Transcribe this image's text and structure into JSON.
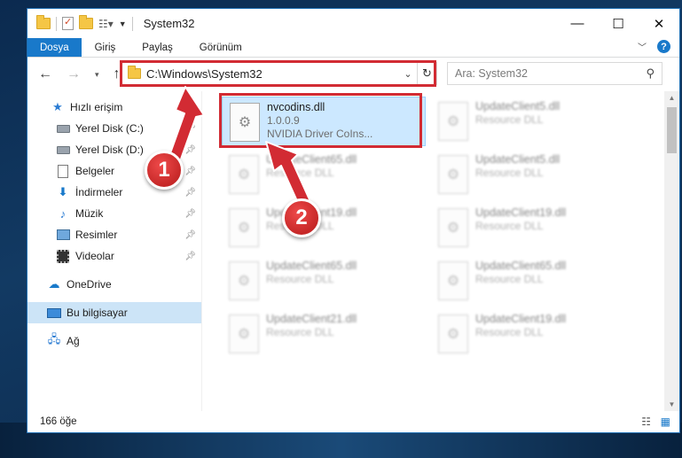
{
  "window": {
    "title": "System32",
    "controls": {
      "minimize": "—",
      "maximize": "☐",
      "close": "✕"
    }
  },
  "ribbon": {
    "tabs": [
      "Dosya",
      "Giriş",
      "Paylaş",
      "Görünüm"
    ],
    "help": "?"
  },
  "address": {
    "path": "C:\\Windows\\System32",
    "search_placeholder": "Ara: System32"
  },
  "sidebar": {
    "items": [
      {
        "label": "Hızlı erişim",
        "icon": "star-icon",
        "pinned": false
      },
      {
        "label": "Yerel Disk (C:)",
        "icon": "drive-icon",
        "pinned": true
      },
      {
        "label": "Yerel Disk (D:)",
        "icon": "drive-icon",
        "pinned": true
      },
      {
        "label": "Belgeler",
        "icon": "documents-icon",
        "pinned": true
      },
      {
        "label": "İndirmeler",
        "icon": "downloads-icon",
        "pinned": true
      },
      {
        "label": "Müzik",
        "icon": "music-icon",
        "pinned": true
      },
      {
        "label": "Resimler",
        "icon": "pictures-icon",
        "pinned": true
      },
      {
        "label": "Videolar",
        "icon": "videos-icon",
        "pinned": true
      },
      {
        "label": "OneDrive",
        "icon": "onedrive-icon",
        "pinned": false
      },
      {
        "label": "Bu bilgisayar",
        "icon": "this-pc-icon",
        "pinned": false,
        "selected": true
      },
      {
        "label": "Ağ",
        "icon": "network-icon",
        "pinned": false
      }
    ]
  },
  "files": [
    {
      "name": "nvcodins.dll",
      "line2": "1.0.0.9",
      "line3": "NVIDIA Driver CoIns..."
    },
    {
      "name": "UpdateClient5.dll",
      "line2": "Resource DLL"
    },
    {
      "name": "UpdateClient65.dll",
      "line2": "Resource DLL"
    },
    {
      "name": "UpdateClient5.dll",
      "line2": "Resource DLL"
    },
    {
      "name": "UpdateClient19.dll",
      "line2": "Resource DLL"
    },
    {
      "name": "UpdateClient19.dll",
      "line2": "Resource DLL"
    },
    {
      "name": "UpdateClient65.dll",
      "line2": "Resource DLL"
    },
    {
      "name": "UpdateClient65.dll",
      "line2": "Resource DLL"
    },
    {
      "name": "UpdateClient21.dll",
      "line2": "Resource DLL"
    },
    {
      "name": "UpdateClient19.dll",
      "line2": "Resource DLL"
    }
  ],
  "status": {
    "count": "166 öğe"
  },
  "annotations": {
    "badge1": "1",
    "badge2": "2",
    "color": "#d22b33"
  }
}
